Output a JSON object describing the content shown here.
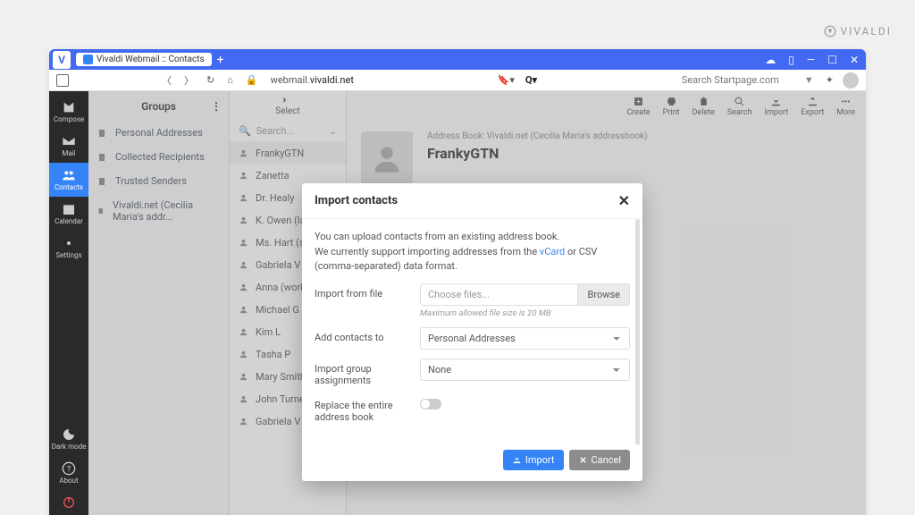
{
  "brand": "VIVALDI",
  "titlebar": {
    "tab": "Vivaldi Webmail :: Contacts"
  },
  "addrbar": {
    "url_prefix": "webmail.",
    "url_domain": "vivaldi.net",
    "search_placeholder": "Search Startpage.com"
  },
  "sidebar": {
    "items": [
      "Compose",
      "Mail",
      "Contacts",
      "Calendar",
      "Settings"
    ],
    "bottom": [
      "Dark mode",
      "About"
    ]
  },
  "groups": {
    "title": "Groups",
    "items": [
      "Personal Addresses",
      "Collected Recipients",
      "Trusted Senders",
      "Vivaldi.net (Cecilia Maria's addr..."
    ]
  },
  "contacts": {
    "select": "Select",
    "search": "Search...",
    "items": [
      "FrankyGTN",
      "Zanetta",
      "Dr. Healy",
      "K. Owen (land",
      "Ms. Hart (sch",
      "Gabriela V",
      "Anna (work)",
      "Michael G",
      "Kim L",
      "Tasha P",
      "Mary Smith",
      "John Turner",
      "Gabriela V"
    ]
  },
  "toolbar": {
    "items": [
      "Create",
      "Print",
      "Delete",
      "Search",
      "Import",
      "Export",
      "More"
    ]
  },
  "detail": {
    "breadcrumb": "Address Book: Vivaldi.net (Cecilia Maria's addressbook)",
    "name": "FrankyGTN"
  },
  "modal": {
    "title": "Import contacts",
    "desc1": "You can upload contacts from an existing address book.",
    "desc2a": "We currently support importing addresses from the ",
    "desc2_link": "vCard",
    "desc2b": " or CSV (comma-separated) data format.",
    "import_file_label": "Import from file",
    "choose_files": "Choose files...",
    "browse": "Browse",
    "max_hint": "Maximum allowed file size is 20 MB",
    "add_to_label": "Add contacts to",
    "add_to_value": "Personal Addresses",
    "group_label": "Import group assignments",
    "group_value": "None",
    "replace_label": "Replace the entire address book",
    "import_btn": "Import",
    "cancel_btn": "Cancel"
  }
}
